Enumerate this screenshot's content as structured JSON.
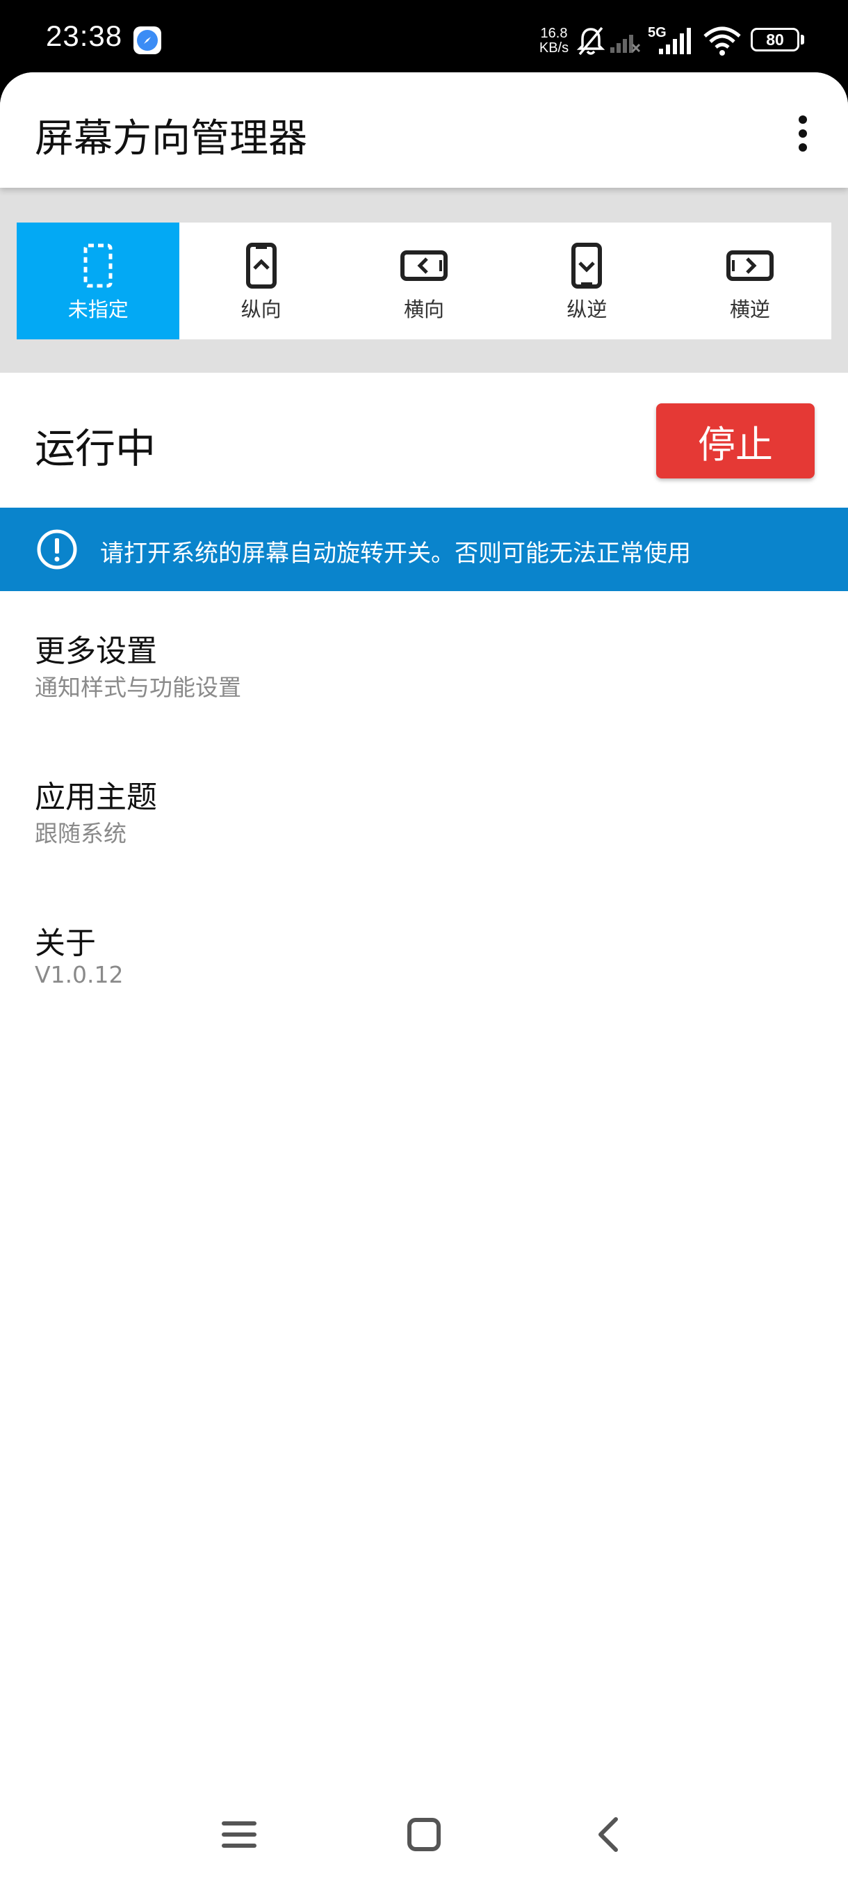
{
  "status_bar": {
    "time": "23:38",
    "speed_value": "16.8",
    "speed_unit": "KB/s",
    "network": "5G",
    "battery": "80"
  },
  "app_bar": {
    "title": "屏幕方向管理器"
  },
  "orientations": [
    {
      "label": "未指定",
      "icon": "unspecified-icon",
      "selected": true
    },
    {
      "label": "纵向",
      "icon": "portrait-icon",
      "selected": false
    },
    {
      "label": "横向",
      "icon": "landscape-icon",
      "selected": false
    },
    {
      "label": "纵逆",
      "icon": "reverse-portrait-icon",
      "selected": false
    },
    {
      "label": "横逆",
      "icon": "reverse-landscape-icon",
      "selected": false
    }
  ],
  "service": {
    "status": "运行中",
    "stop_label": "停止",
    "stop_color": "#e53935"
  },
  "banner": {
    "text": "请打开系统的屏幕自动旋转开关。否则可能无法正常使用",
    "color": "#0a84cc"
  },
  "settings": [
    {
      "title": "更多设置",
      "subtitle": "通知样式与功能设置"
    },
    {
      "title": "应用主题",
      "subtitle": "跟随系统"
    },
    {
      "title": "关于",
      "subtitle": "V1.0.12"
    }
  ],
  "colors": {
    "accent": "#03a9f4"
  }
}
